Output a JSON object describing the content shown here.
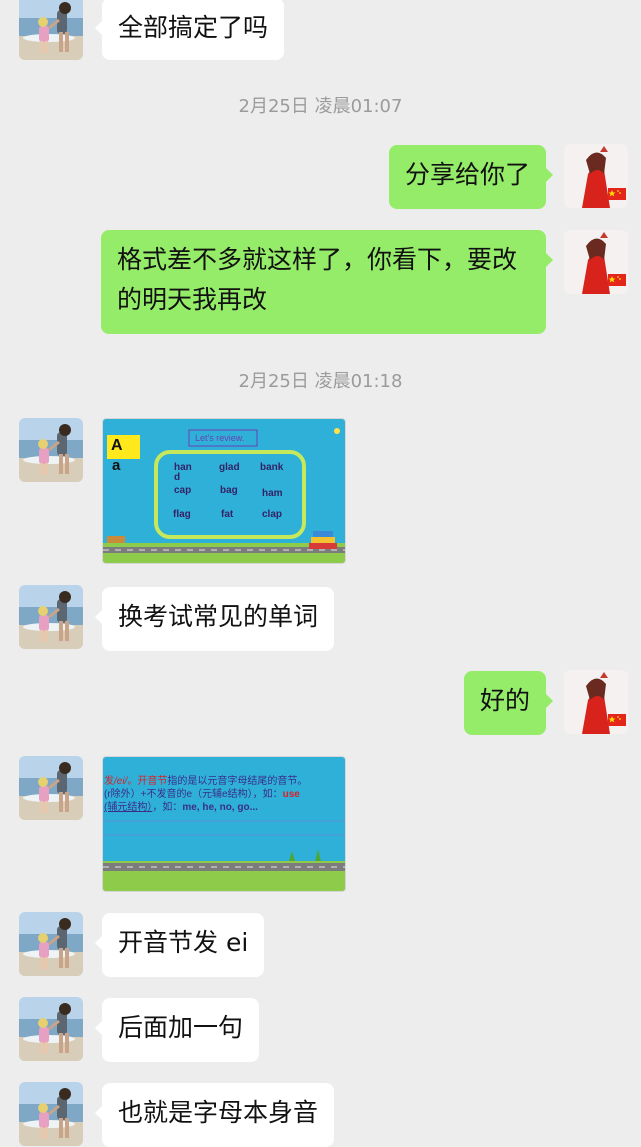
{
  "messages": {
    "m1": "全部搞定了吗",
    "t1": "2月25日 凌晨01:07",
    "m2": "分享给你了",
    "m3": "格式差不多就这样了，你看下，要改的明天我再改",
    "t2": "2月25日 凌晨01:18",
    "m5": "换考试常见的单词",
    "m6": "好的",
    "m8": "开音节发 ei",
    "m9": "后面加一句",
    "m10": "也就是字母本身音"
  },
  "image1": {
    "title": "Let's review.",
    "letter_upper": "A",
    "letter_lower": "a",
    "words": [
      "han",
      "d",
      "glad",
      "bank",
      "cap",
      "bag",
      "ham",
      "flag",
      "fat",
      "clap"
    ]
  },
  "image2": {
    "line1_a": "发",
    "line1_b": "/ei/",
    "line1_c": "。",
    "line1_d": "开音节",
    "line1_e": "指的是以元音字母结尾的音节。",
    "line2_a": "(r除外）+不发音的e（元辅e结构），如：",
    "line2_b": "use",
    "line3_a": "(辅元结构）",
    "line3_b": "，如：",
    "line3_c": "me, he, no, go..."
  },
  "colors": {
    "incoming_bubble": "#ffffff",
    "outgoing_bubble": "#95ec69",
    "background": "#ededed",
    "timestamp": "#9b9b9b"
  },
  "icons": {
    "contact_avatar": "contact-avatar",
    "self_avatar": "self-avatar"
  }
}
